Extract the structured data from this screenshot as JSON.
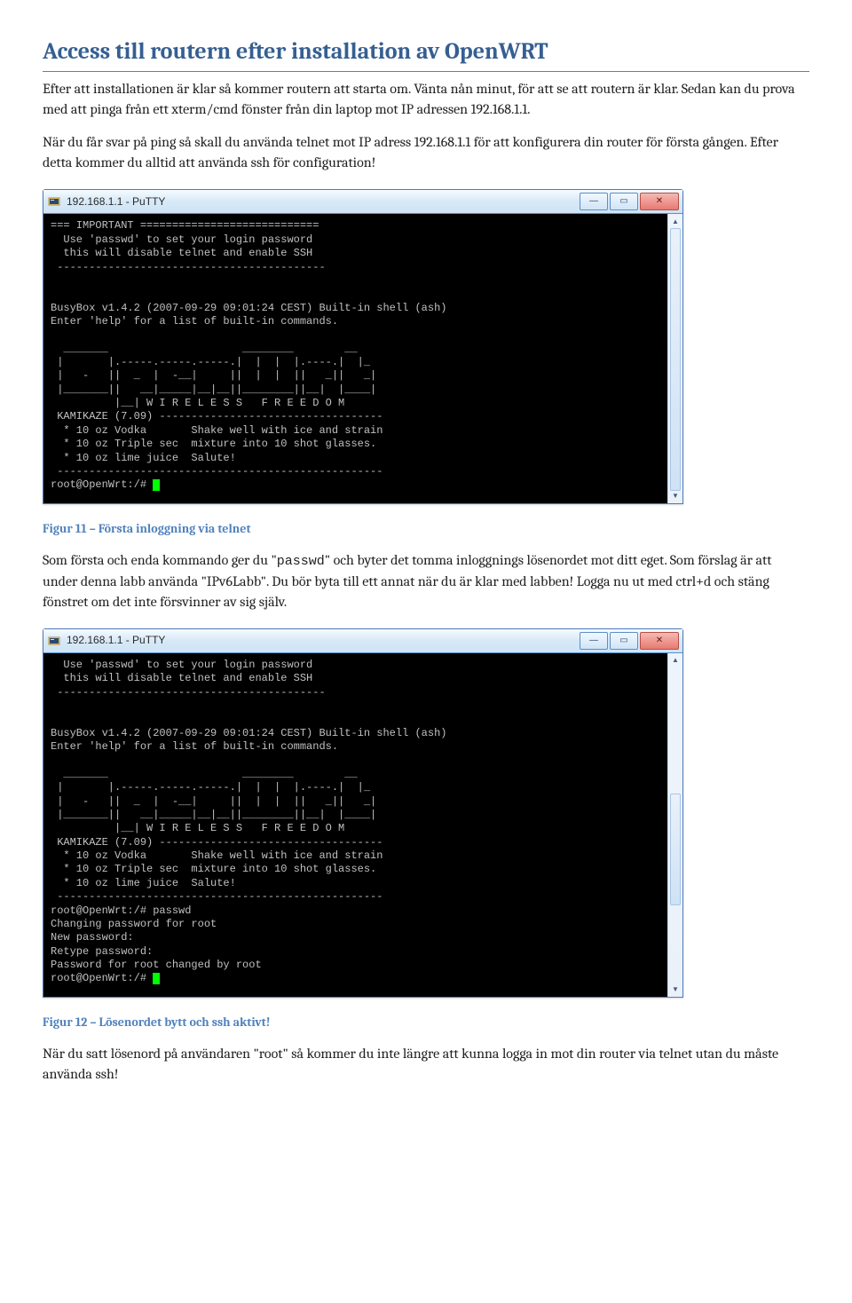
{
  "heading": "Access till routern efter installation av OpenWRT",
  "p1a": "Efter att installationen är klar så kommer routern att starta om. Vänta nån minut, för att se att routern är klar. Sedan kan du prova med att pinga från ett xterm/cmd fönster från din laptop mot IP adressen 192.168.1.1.",
  "p1b": "När du får svar på ping så skall du använda telnet mot IP adress 192.168.1.1 för att konfigurera din router för första gången. Efter detta kommer du alltid att använda ssh för configuration!",
  "win1": {
    "title": "192.168.1.1 - PuTTY",
    "body": "=== IMPORTANT ============================\n  Use 'passwd' to set your login password\n  this will disable telnet and enable SSH\n ------------------------------------------\n\n\nBusyBox v1.4.2 (2007-09-29 09:01:24 CEST) Built-in shell (ash)\nEnter 'help' for a list of built-in commands.\n\n  _______                     ________        __\n |       |.-----.-----.-----.|  |  |  |.----.|  |_\n |   -   ||  _  |  -__|     ||  |  |  ||   _||   _|\n |_______||   __|_____|__|__||________||__|  |____|\n          |__| W I R E L E S S   F R E E D O M\n KAMIKAZE (7.09) -----------------------------------\n  * 10 oz Vodka       Shake well with ice and strain\n  * 10 oz Triple sec  mixture into 10 shot glasses.\n  * 10 oz lime juice  Salute!\n ---------------------------------------------------\nroot@OpenWrt:/# "
  },
  "cap1": "Figur 11 – Första inloggning via telnet",
  "p2a": "Som första och enda kommando ger du \"",
  "p2cmd": "passwd",
  "p2b": "\" och byter det tomma inloggnings lösenordet mot ditt eget. Som förslag är att under denna labb använda \"IPv6Labb\". Du bör byta till ett annat när du är klar med labben! Logga nu ut med ctrl+d och stäng fönstret om det inte försvinner av sig själv.",
  "win2": {
    "title": "192.168.1.1 - PuTTY",
    "body": "  Use 'passwd' to set your login password\n  this will disable telnet and enable SSH\n ------------------------------------------\n\n\nBusyBox v1.4.2 (2007-09-29 09:01:24 CEST) Built-in shell (ash)\nEnter 'help' for a list of built-in commands.\n\n  _______                     ________        __\n |       |.-----.-----.-----.|  |  |  |.----.|  |_\n |   -   ||  _  |  -__|     ||  |  |  ||   _||   _|\n |_______||   __|_____|__|__||________||__|  |____|\n          |__| W I R E L E S S   F R E E D O M\n KAMIKAZE (7.09) -----------------------------------\n  * 10 oz Vodka       Shake well with ice and strain\n  * 10 oz Triple sec  mixture into 10 shot glasses.\n  * 10 oz lime juice  Salute!\n ---------------------------------------------------\nroot@OpenWrt:/# passwd\nChanging password for root\nNew password:\nRetype password:\nPassword for root changed by root\nroot@OpenWrt:/# "
  },
  "cap2": "Figur 12 – Lösenordet bytt och ssh aktivt!",
  "p3": "När du satt lösenord på användaren \"root\" så kommer du inte längre att kunna logga in mot din router via telnet utan du måste använda ssh!"
}
